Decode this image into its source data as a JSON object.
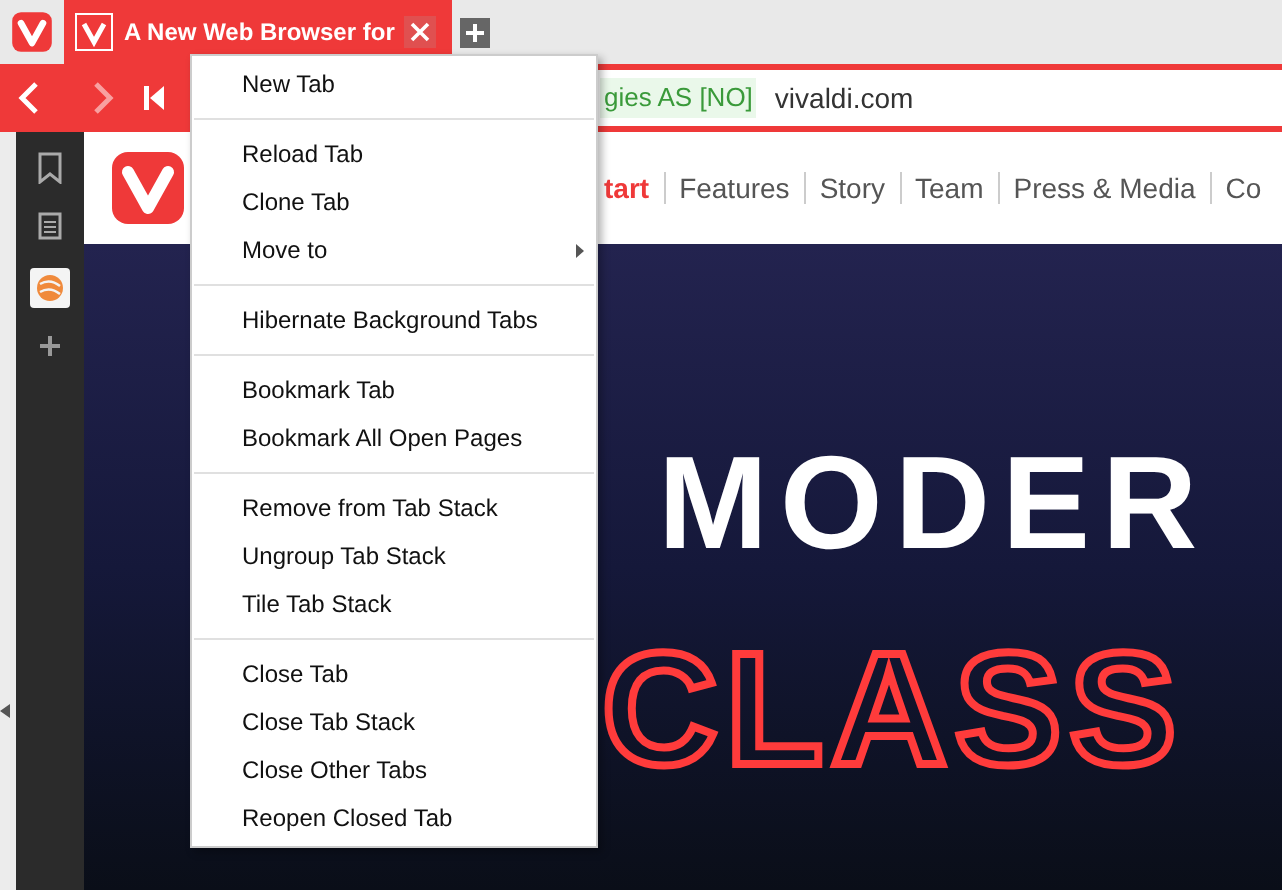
{
  "tab": {
    "title": "A New Web Browser for",
    "selected": true
  },
  "address_bar": {
    "certificate": "gies AS [NO]",
    "url": "vivaldi.com"
  },
  "site_nav": [
    {
      "label": "tart",
      "selected": true
    },
    {
      "label": "Features",
      "selected": false
    },
    {
      "label": "Story",
      "selected": false
    },
    {
      "label": "Team",
      "selected": false
    },
    {
      "label": "Press & Media",
      "selected": false
    },
    {
      "label": "Co",
      "selected": false
    }
  ],
  "hero": {
    "headline": "MODER",
    "subheadline": "CLASS"
  },
  "context_menu": {
    "sections": [
      [
        {
          "label": "New Tab",
          "submenu": false
        }
      ],
      [
        {
          "label": "Reload Tab",
          "submenu": false
        },
        {
          "label": "Clone Tab",
          "submenu": false
        },
        {
          "label": "Move to",
          "submenu": true
        }
      ],
      [
        {
          "label": "Hibernate Background Tabs",
          "submenu": false
        }
      ],
      [
        {
          "label": "Bookmark Tab",
          "submenu": false
        },
        {
          "label": "Bookmark All Open Pages",
          "submenu": false
        }
      ],
      [
        {
          "label": "Remove from Tab Stack",
          "submenu": false
        },
        {
          "label": "Ungroup Tab Stack",
          "submenu": false
        },
        {
          "label": "Tile Tab Stack",
          "submenu": false
        }
      ],
      [
        {
          "label": "Close Tab",
          "submenu": false
        },
        {
          "label": "Close Tab Stack",
          "submenu": false
        },
        {
          "label": "Close Other Tabs",
          "submenu": false
        },
        {
          "label": "Reopen Closed Tab",
          "submenu": false
        }
      ]
    ]
  }
}
